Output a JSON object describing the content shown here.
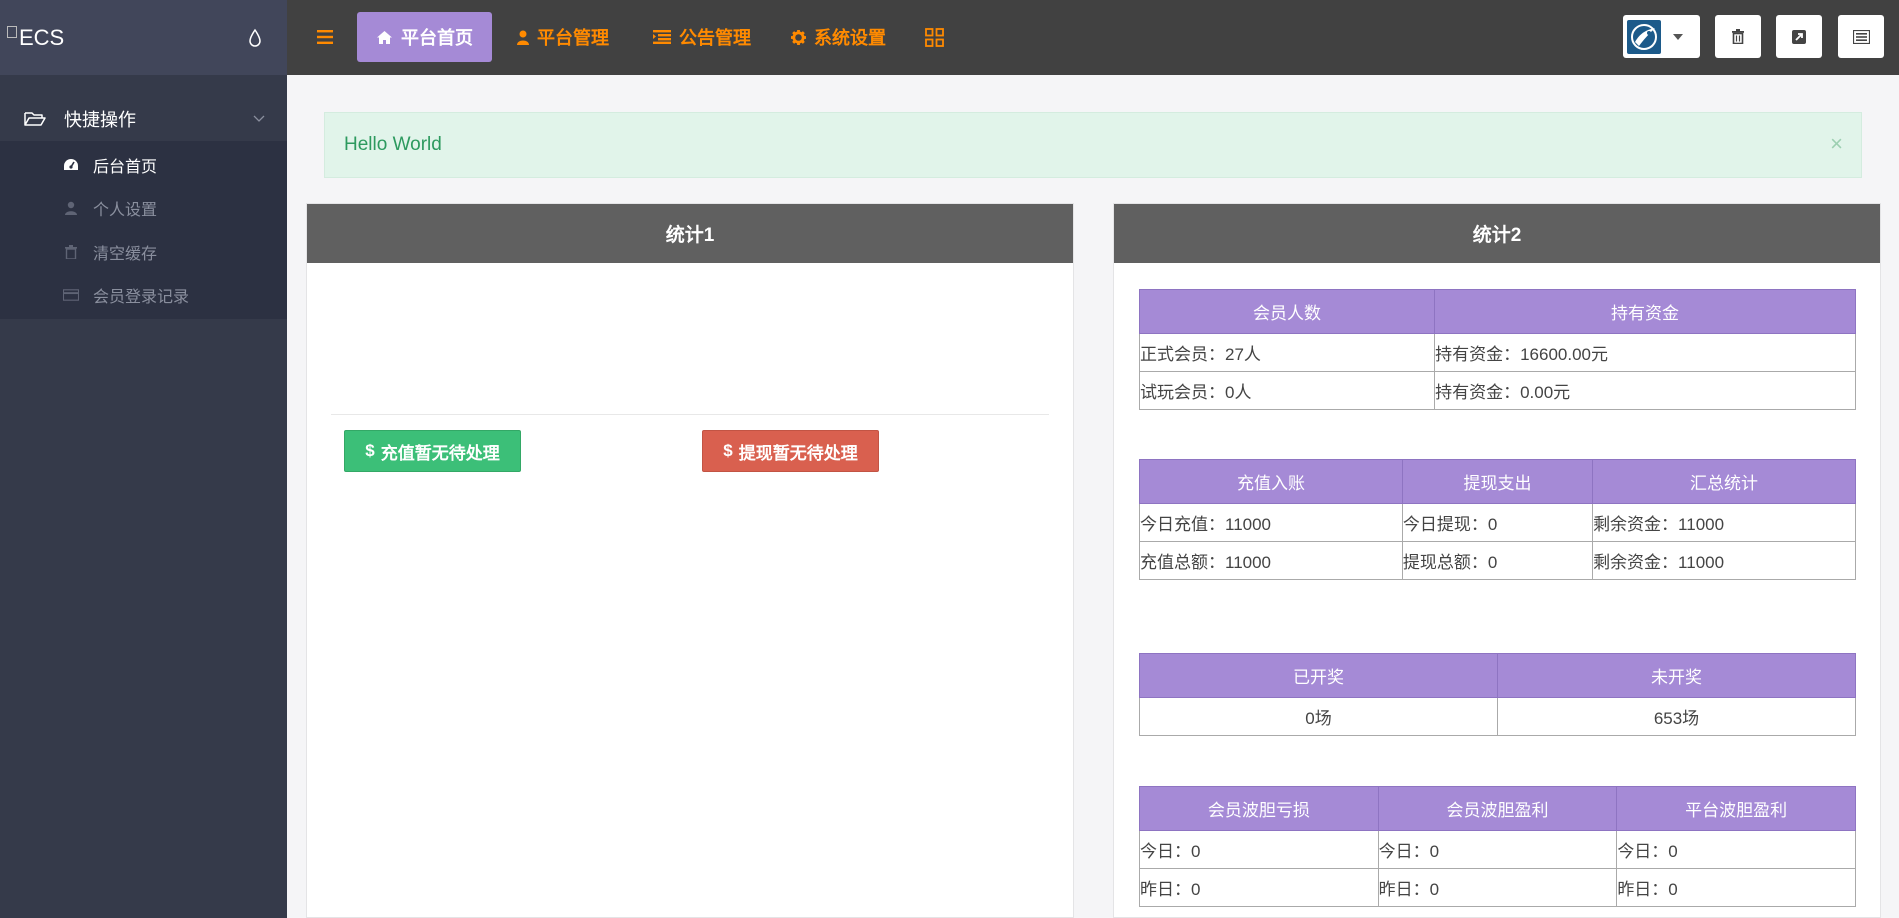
{
  "sidebar": {
    "logo_text": "ECS",
    "group": {
      "label": "快捷操作"
    },
    "items": [
      {
        "label": "后台首页",
        "icon": "dashboard-icon"
      },
      {
        "label": "个人设置",
        "icon": "user-icon"
      },
      {
        "label": "清空缓存",
        "icon": "trash-icon"
      },
      {
        "label": "会员登录记录",
        "icon": "card-icon"
      }
    ]
  },
  "topbar": {
    "nav": [
      {
        "label": "平台首页",
        "icon": "home-icon"
      },
      {
        "label": "平台管理",
        "icon": "user-icon"
      },
      {
        "label": "公告管理",
        "icon": "list-icon"
      },
      {
        "label": "系统设置",
        "icon": "gear-icon"
      }
    ]
  },
  "alert": {
    "text": "Hello World",
    "close": "×"
  },
  "panel1": {
    "title": "统计1",
    "recharge_button": "充值暂无待处理",
    "withdraw_button": "提现暂无待处理"
  },
  "panel2": {
    "title": "统计2",
    "members_table": {
      "headers": [
        "会员人数",
        "持有资金"
      ],
      "rows": [
        [
          "正式会员：27人",
          "持有资金：16600.00元"
        ],
        [
          "试玩会员：0人",
          "持有资金：0.00元"
        ]
      ]
    },
    "money_table": {
      "headers": [
        "充值入账",
        "提现支出",
        "汇总统计"
      ],
      "rows": [
        [
          "今日充值：11000",
          "今日提现：0",
          "剩余资金：11000"
        ],
        [
          "充值总额：11000",
          "提现总额：0",
          "剩余资金：11000"
        ]
      ]
    },
    "draw_table": {
      "headers": [
        "已开奖",
        "未开奖"
      ],
      "rows": [
        [
          "0场",
          "653场"
        ]
      ]
    },
    "bets_table": {
      "headers": [
        "会员波胆亏损",
        "会员波胆盈利",
        "平台波胆盈利"
      ],
      "rows": [
        [
          "今日：0",
          "今日：0",
          "今日：0"
        ],
        [
          "昨日：0",
          "昨日：0",
          "昨日：0"
        ]
      ]
    }
  },
  "colors": {
    "accent": "#a58ad6",
    "nav_text": "#ff8a00",
    "sidebar_bg": "#353a4a",
    "topbar_bg": "#414141",
    "success": "#3cbf78",
    "danger": "#d9604f"
  }
}
